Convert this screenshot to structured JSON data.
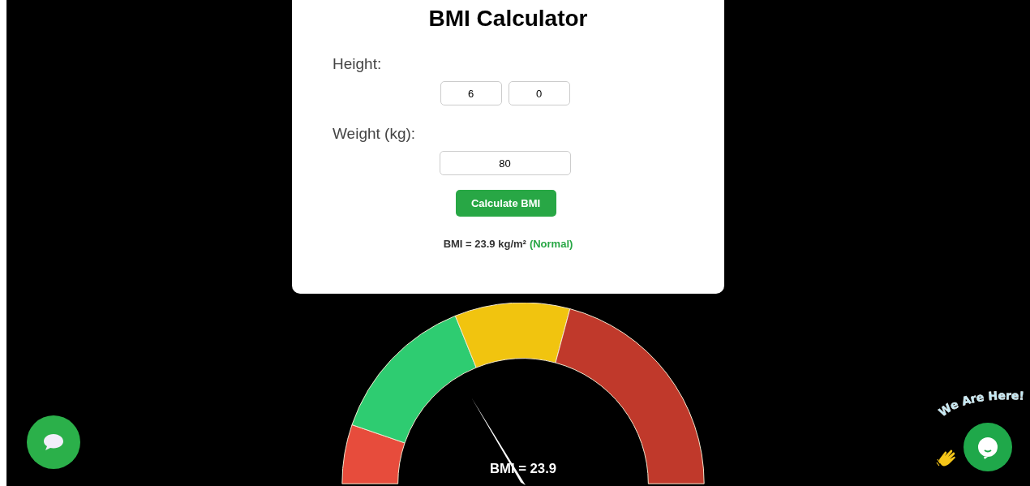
{
  "title": "BMI Calculator",
  "height": {
    "label": "Height:",
    "feet": "6",
    "inches": "0"
  },
  "weight": {
    "label": "Weight (kg):",
    "value": "80"
  },
  "button": "Calculate BMI",
  "result": {
    "text": "BMI = 23.9 kg/m²",
    "category": "(Normal)",
    "color": "#28a745"
  },
  "gauge": {
    "reading": "BMI = 23.9",
    "segments": [
      {
        "color": "#e74c3c"
      },
      {
        "color": "#2ecc71"
      },
      {
        "color": "#f1c40f"
      },
      {
        "color": "#c0392b"
      }
    ]
  },
  "chat_badge": {
    "text": "We Are Here!"
  }
}
